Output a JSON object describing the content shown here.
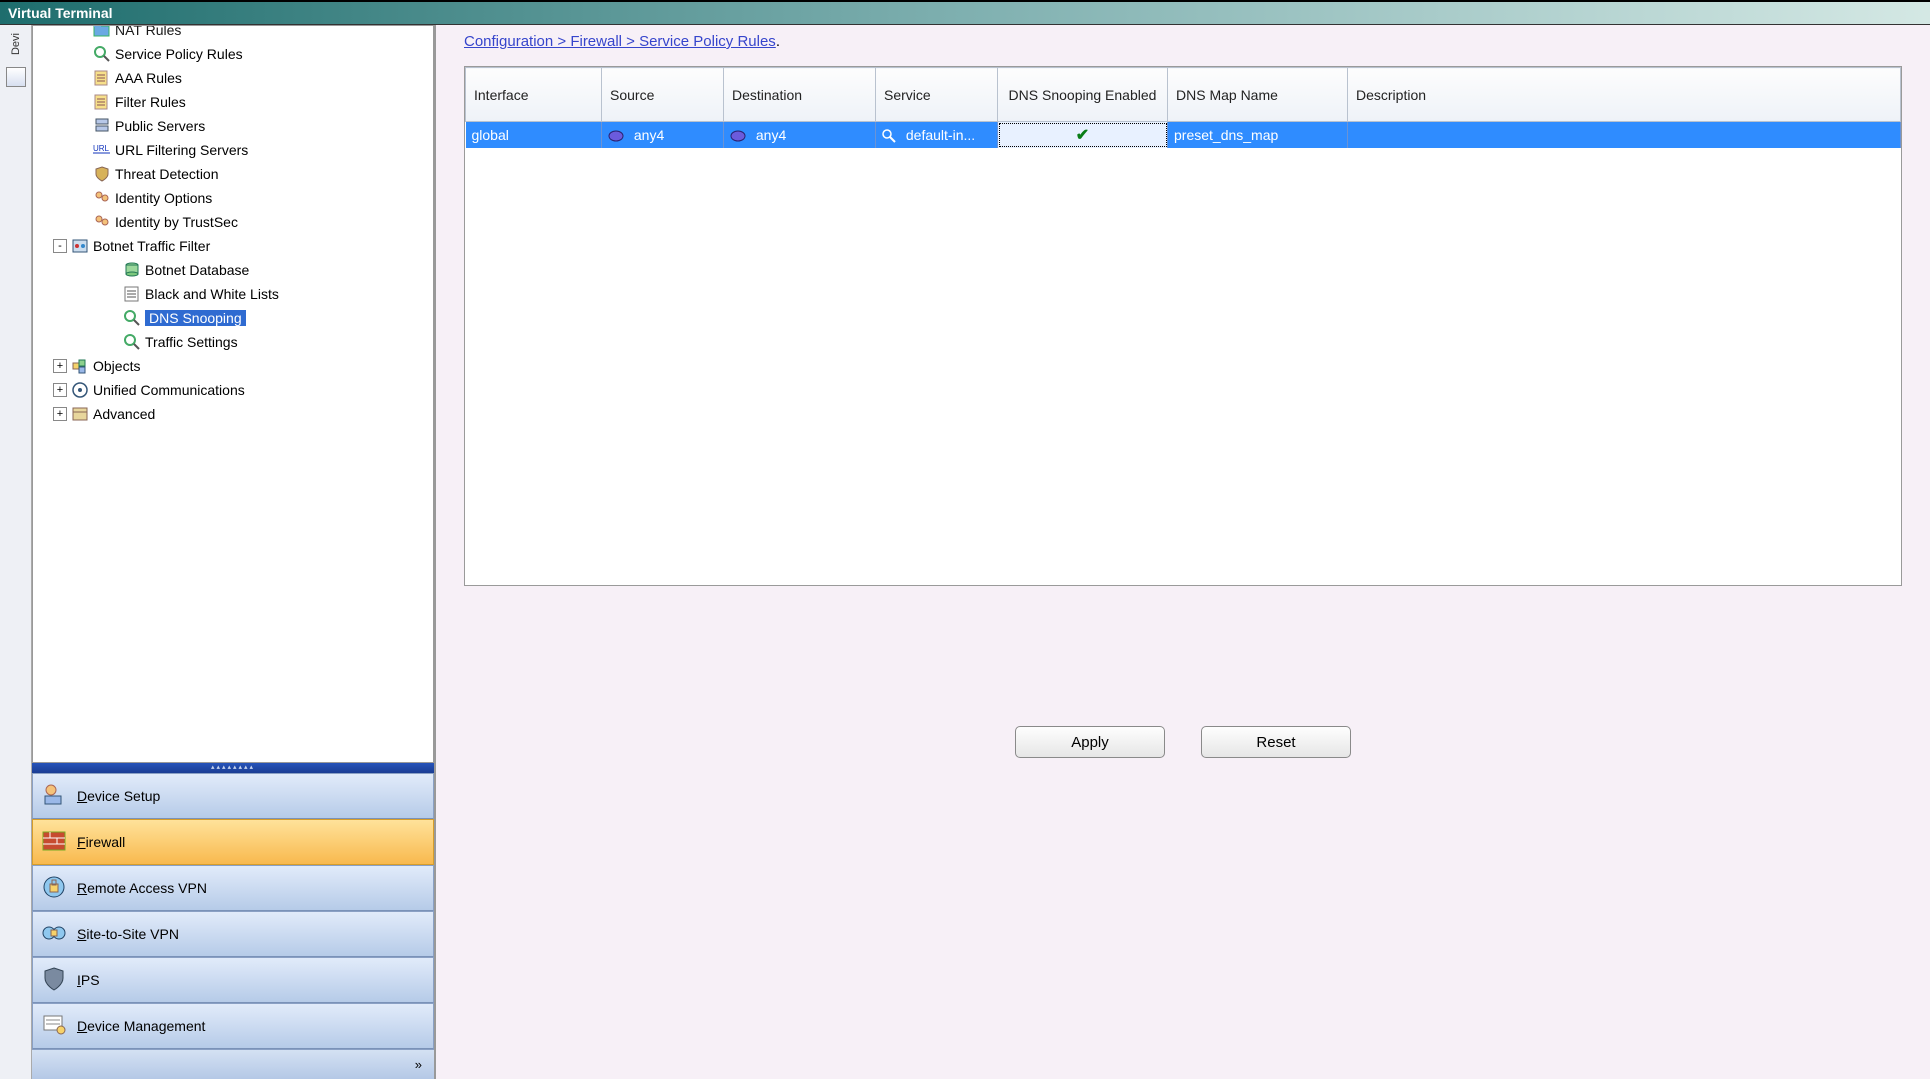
{
  "window": {
    "title": "Virtual Terminal"
  },
  "leftStrip": {
    "tabLabel": "Devi"
  },
  "tree": {
    "items": [
      {
        "label": "NAT Rules",
        "icon": "folder",
        "depth": 0,
        "cut": true
      },
      {
        "label": "Service Policy Rules",
        "icon": "magnifier",
        "depth": 0
      },
      {
        "label": "AAA Rules",
        "icon": "rules",
        "depth": 0
      },
      {
        "label": "Filter Rules",
        "icon": "rules",
        "depth": 0
      },
      {
        "label": "Public Servers",
        "icon": "server",
        "depth": 0
      },
      {
        "label": "URL Filtering Servers",
        "icon": "url",
        "depth": 0
      },
      {
        "label": "Threat Detection",
        "icon": "shield",
        "depth": 0
      },
      {
        "label": "Identity Options",
        "icon": "identity",
        "depth": 0
      },
      {
        "label": "Identity by TrustSec",
        "icon": "identity",
        "depth": 0
      },
      {
        "label": "Botnet Traffic Filter",
        "icon": "botnet",
        "depth": 0,
        "expander": "-",
        "expandable": true
      },
      {
        "label": "Botnet Database",
        "icon": "db",
        "depth": 1
      },
      {
        "label": "Black and White Lists",
        "icon": "list",
        "depth": 1
      },
      {
        "label": "DNS Snooping",
        "icon": "magnifier",
        "depth": 1,
        "selected": true
      },
      {
        "label": "Traffic Settings",
        "icon": "magnifier",
        "depth": 1
      },
      {
        "label": "Objects",
        "icon": "objects",
        "depth": 0,
        "expander": "+",
        "expandable": true
      },
      {
        "label": "Unified Communications",
        "icon": "uc",
        "depth": 0,
        "expander": "+",
        "expandable": true
      },
      {
        "label": "Advanced",
        "icon": "advanced",
        "depth": 0,
        "expander": "+",
        "expandable": true
      }
    ]
  },
  "navSections": [
    {
      "label": "Device Setup",
      "icon": "device",
      "active": false
    },
    {
      "label": "Firewall",
      "icon": "firewall",
      "active": true
    },
    {
      "label": "Remote Access VPN",
      "icon": "ravpn",
      "active": false
    },
    {
      "label": "Site-to-Site VPN",
      "icon": "s2svpn",
      "active": false
    },
    {
      "label": "IPS",
      "icon": "ips",
      "active": false
    },
    {
      "label": "Device Management",
      "icon": "devmgmt",
      "active": false
    }
  ],
  "navFooter": {
    "expand": "»"
  },
  "content": {
    "linkText": "Configuration > Firewall > Service Policy Rules",
    "linkSuffix": ".",
    "table": {
      "columns": [
        "Interface",
        "Source",
        "Destination",
        "Service",
        "DNS Snooping Enabled",
        "DNS Map Name",
        "Description"
      ],
      "rows": [
        {
          "interface": "global",
          "source": "any4",
          "destination": "any4",
          "service": "default-in...",
          "dnsEnabled": "✔",
          "dnsMap": "preset_dns_map",
          "description": ""
        }
      ]
    },
    "buttons": {
      "apply": "Apply",
      "reset": "Reset"
    }
  }
}
